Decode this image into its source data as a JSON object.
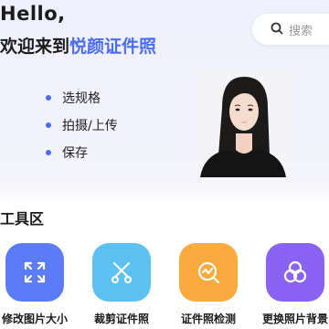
{
  "header": {
    "greeting": "Hello,",
    "welcome_prefix": "欢迎来到",
    "brand": "悦颜证件照"
  },
  "search": {
    "icon": "search-icon",
    "placeholder": "搜索"
  },
  "features": [
    {
      "label": "选规格"
    },
    {
      "label": "拍摄/上传"
    },
    {
      "label": "保存"
    }
  ],
  "section": {
    "title": "工具区"
  },
  "tools": [
    {
      "label": "修改图片大小",
      "icon": "resize-icon",
      "color": "#5b7cf6"
    },
    {
      "label": "裁剪证件照",
      "icon": "scissors-icon",
      "color": "#5cc0f2"
    },
    {
      "label": "证件照检测",
      "icon": "detect-icon",
      "color": "#f8aa3c"
    },
    {
      "label": "更换照片背景",
      "icon": "background-icon",
      "color": "#8b63f4"
    }
  ],
  "colors": {
    "accent": "#4b6cf5",
    "text": "#1b1b1b"
  }
}
